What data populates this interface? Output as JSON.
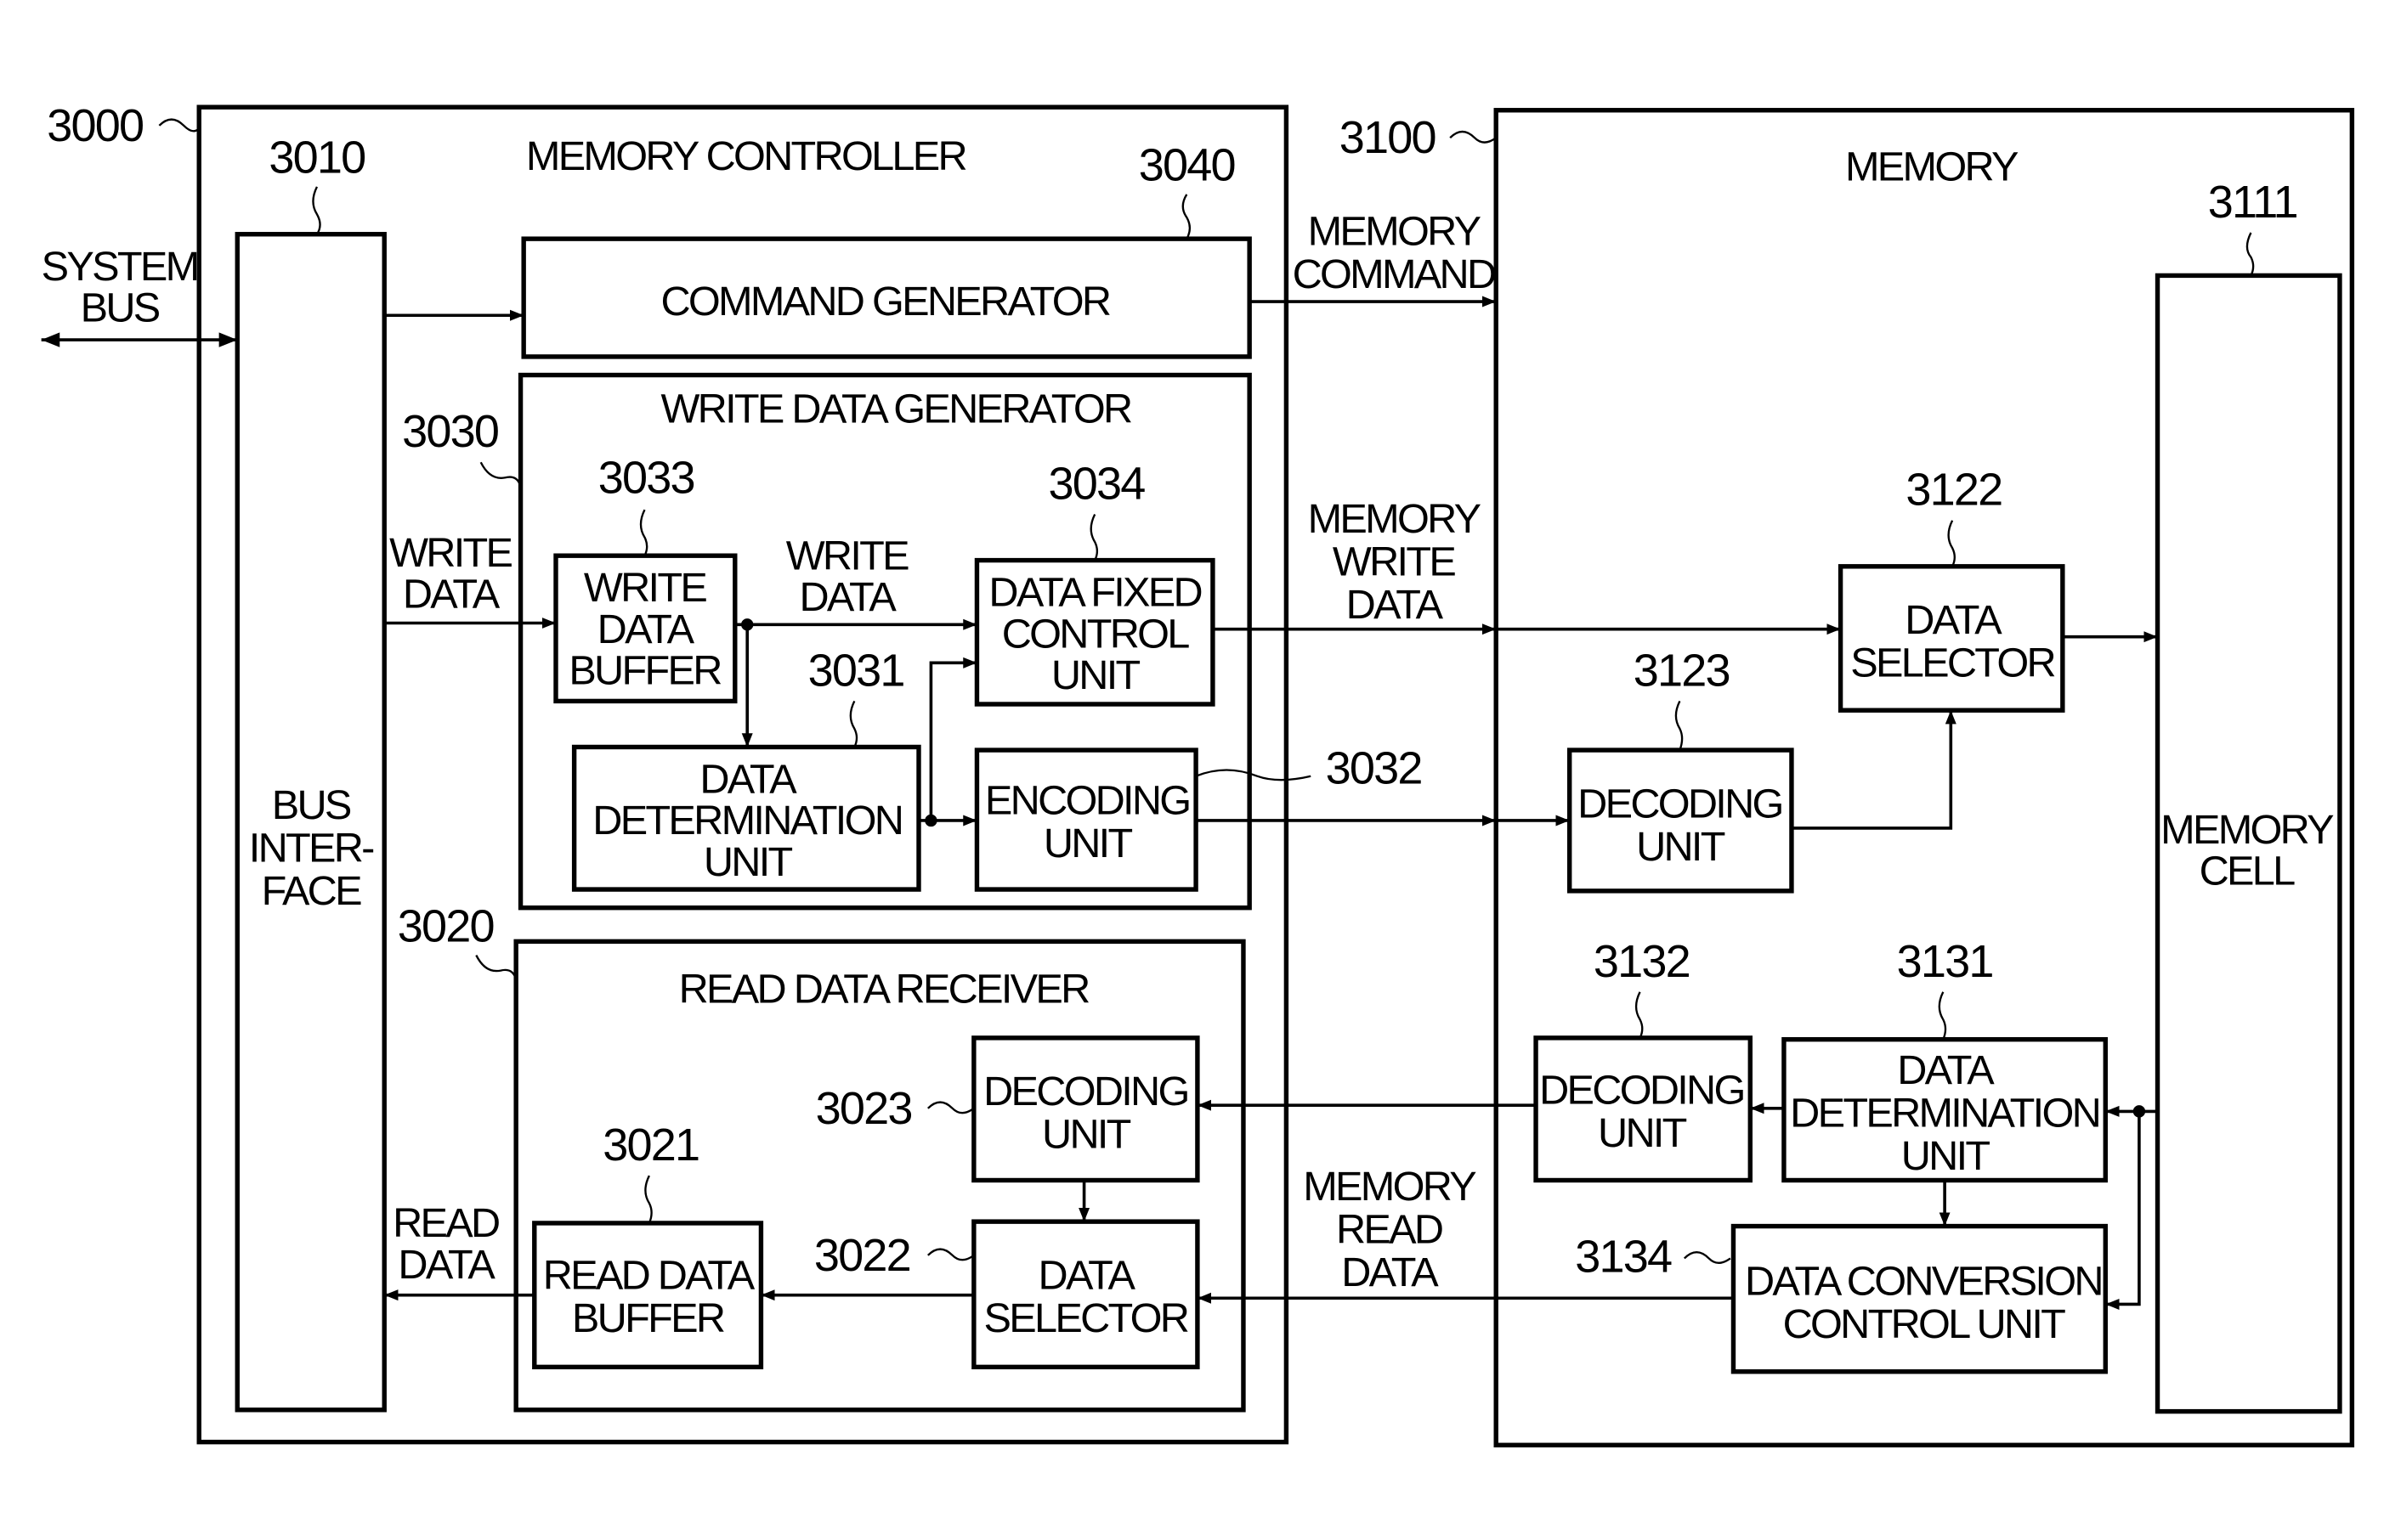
{
  "controller": {
    "ref": "3000",
    "title": "MEMORY CONTROLLER",
    "bus_interface": {
      "ref": "3010",
      "lines": [
        "BUS",
        "INTER-",
        "FACE"
      ]
    },
    "command_generator": {
      "ref": "3040",
      "label": "COMMAND GENERATOR"
    },
    "write_data_generator": {
      "ref": "3030",
      "title": "WRITE DATA GENERATOR",
      "write_data_buffer": {
        "ref": "3033",
        "lines": [
          "WRITE",
          "DATA",
          "BUFFER"
        ]
      },
      "data_fixed_control_unit": {
        "ref": "3034",
        "lines": [
          "DATA FIXED",
          "CONTROL",
          "UNIT"
        ]
      },
      "data_determination_unit": {
        "ref": "3031",
        "lines": [
          "DATA",
          "DETERMINATION",
          "UNIT"
        ]
      },
      "encoding_unit": {
        "ref": "3032",
        "lines": [
          "ENCODING",
          "UNIT"
        ]
      },
      "inner_signal": [
        "WRITE",
        "DATA"
      ]
    },
    "read_data_receiver": {
      "ref": "3020",
      "title": "READ DATA RECEIVER",
      "decoding_unit": {
        "ref": "3023",
        "lines": [
          "DECODING",
          "UNIT"
        ]
      },
      "data_selector": {
        "ref": "3022",
        "lines": [
          "DATA",
          "SELECTOR"
        ]
      },
      "read_data_buffer": {
        "ref": "3021",
        "lines": [
          "READ DATA",
          "BUFFER"
        ]
      }
    },
    "signals": {
      "write_data": [
        "WRITE",
        "DATA"
      ],
      "read_data": [
        "READ",
        "DATA"
      ]
    }
  },
  "system_bus": [
    "SYSTEM",
    "BUS"
  ],
  "memory": {
    "ref": "3100",
    "title": "MEMORY",
    "memory_cell": {
      "ref": "3111",
      "lines": [
        "MEMORY",
        "CELL"
      ]
    },
    "data_selector": {
      "ref": "3122",
      "lines": [
        "DATA",
        "SELECTOR"
      ]
    },
    "decoding_unit_write": {
      "ref": "3123",
      "lines": [
        "DECODING",
        "UNIT"
      ]
    },
    "decoding_unit_read": {
      "ref": "3132",
      "lines": [
        "DECODING",
        "UNIT"
      ]
    },
    "data_determination_unit": {
      "ref": "3131",
      "lines": [
        "DATA",
        "DETERMINATION",
        "UNIT"
      ]
    },
    "data_conversion_control_unit": {
      "ref": "3134",
      "lines": [
        "DATA CONVERSION",
        "CONTROL UNIT"
      ]
    }
  },
  "links": {
    "memory_command": [
      "MEMORY",
      "COMMAND"
    ],
    "memory_write_data": [
      "MEMORY",
      "WRITE",
      "DATA"
    ],
    "memory_read_data": [
      "MEMORY",
      "READ",
      "DATA"
    ]
  }
}
